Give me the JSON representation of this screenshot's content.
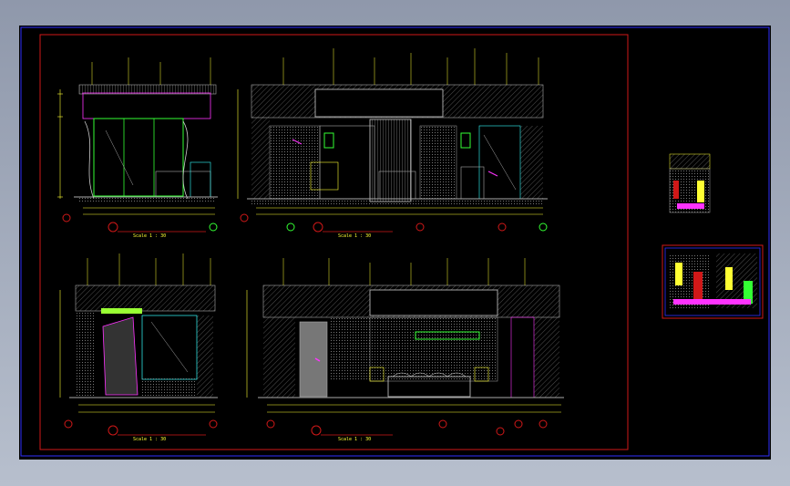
{
  "app": {
    "accent_colors": {
      "background": "#000000",
      "frame_outer": "#3030ff",
      "frame_inner": "#d01818",
      "annotation": "#ffff33",
      "glass": "#33ff33",
      "accent_magenta": "#ff33ff",
      "accent_cyan": "#33ffff",
      "wall": "#aaaaaa"
    }
  },
  "sheet": {
    "panels": [
      {
        "id": "top-left",
        "scale": "Scale 1 : 30"
      },
      {
        "id": "top-right",
        "scale": "Scale 1 : 30"
      },
      {
        "id": "bottom-left",
        "scale": "Scale 1 : 30"
      },
      {
        "id": "bottom-right",
        "scale": "Scale 1 : 30"
      }
    ]
  }
}
